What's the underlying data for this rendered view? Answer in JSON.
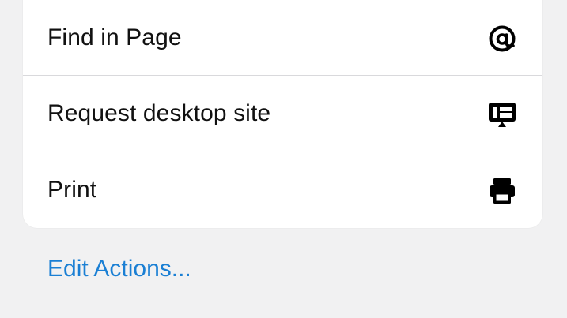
{
  "menu": {
    "items": [
      {
        "label": "Find in Page",
        "icon": "at-sign-icon"
      },
      {
        "label": "Request desktop site",
        "icon": "desktop-monitor-icon"
      },
      {
        "label": "Print",
        "icon": "printer-icon"
      }
    ]
  },
  "footer": {
    "edit_actions_label": "Edit Actions..."
  },
  "colors": {
    "background": "#f1f1f2",
    "card": "#ffffff",
    "text": "#111111",
    "link": "#1a7fd4",
    "divider": "#d9d9dc"
  }
}
